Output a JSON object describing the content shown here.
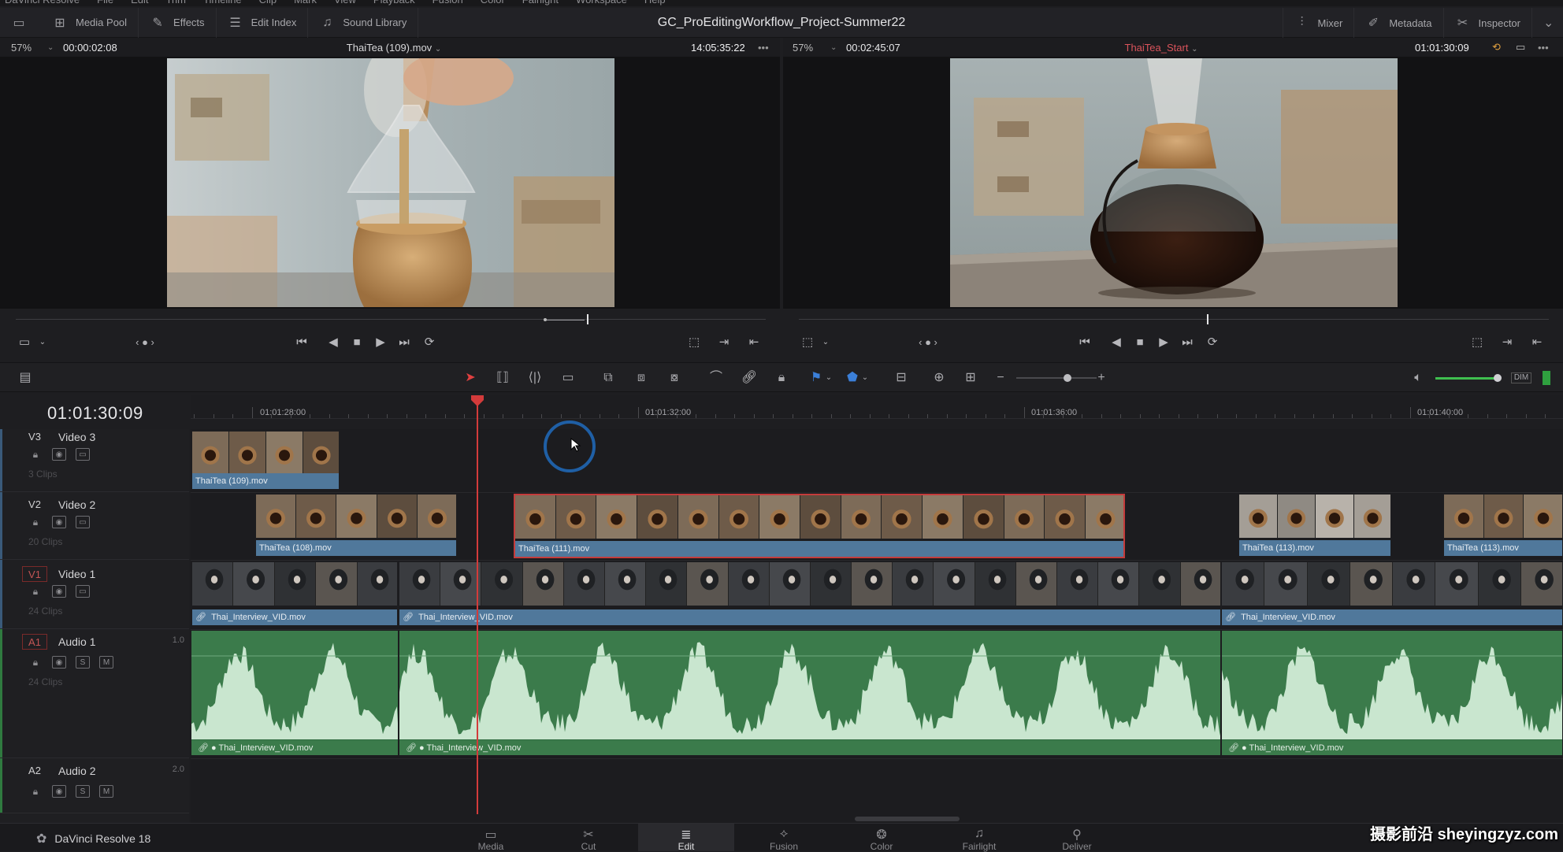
{
  "menubar": [
    "DaVinci Resolve",
    "File",
    "Edit",
    "Trim",
    "Timeline",
    "Clip",
    "Mark",
    "View",
    "Playback",
    "Fusion",
    "Color",
    "Fairlight",
    "Workspace",
    "Help"
  ],
  "toolbar": {
    "left": [
      {
        "label": "Media Pool",
        "icon": "media-pool-icon"
      },
      {
        "label": "Effects",
        "icon": "effects-icon"
      },
      {
        "label": "Edit Index",
        "icon": "edit-index-icon"
      },
      {
        "label": "Sound Library",
        "icon": "sound-library-icon"
      }
    ],
    "title": "GC_ProEditingWorkflow_Project-Summer22",
    "right": [
      {
        "label": "Mixer",
        "icon": "mixer-icon"
      },
      {
        "label": "Metadata",
        "icon": "metadata-icon"
      },
      {
        "label": "Inspector",
        "icon": "inspector-icon"
      }
    ]
  },
  "source_viewer": {
    "zoom": "57%",
    "timecode": "00:00:02:08",
    "clip": "ThaiTea (109).mov",
    "source_tc": "14:05:35:22"
  },
  "timeline_viewer": {
    "zoom": "57%",
    "timecode": "00:02:45:07",
    "timeline": "ThaiTea_Start",
    "record_tc": "01:01:30:09"
  },
  "timeline": {
    "current_tc": "01:01:30:09",
    "ruler_labels": [
      "01:01:28:00",
      "01:01:32:00",
      "01:01:36:00",
      "01:01:40:00"
    ],
    "tracks": [
      {
        "id": "V3",
        "name": "Video 3",
        "clips_count": "3 Clips"
      },
      {
        "id": "V2",
        "name": "Video 2",
        "clips_count": "20 Clips"
      },
      {
        "id": "V1",
        "name": "Video 1",
        "clips_count": "24 Clips"
      },
      {
        "id": "A1",
        "name": "Audio 1",
        "clips_count": "24 Clips",
        "level": "1.0"
      },
      {
        "id": "A2",
        "name": "Audio 2",
        "clips_count": "",
        "level": "2.0"
      }
    ],
    "v3_clips": [
      "ThaiTea (109).mov"
    ],
    "v2_clips": [
      "ThaiTea (108).mov",
      "ThaiTea (111).mov",
      "ThaiTea (113).mov",
      "ThaiTea (113).mov"
    ],
    "v1_clips": [
      "Thai_Interview_VID.mov",
      "Thai_Interview_VID.mov",
      "Thai_Interview_VID.mov"
    ],
    "a1_clips": [
      "Thai_Interview_VID.mov",
      "Thai_Interview_VID.mov",
      "Thai_Interview_VID.mov"
    ],
    "solo_label": "S",
    "mute_label": "M"
  },
  "pages": [
    "Media",
    "Cut",
    "Edit",
    "Fusion",
    "Color",
    "Fairlight",
    "Deliver"
  ],
  "active_page": "Edit",
  "brand": "DaVinci Resolve 18",
  "watermark": "摄影前沿 sheyingzyz.com",
  "colors": {
    "video_clip": "#50789b",
    "audio_clip": "#3b7b4b",
    "playhead": "#d33b3b",
    "selection": "#c43b3b"
  }
}
